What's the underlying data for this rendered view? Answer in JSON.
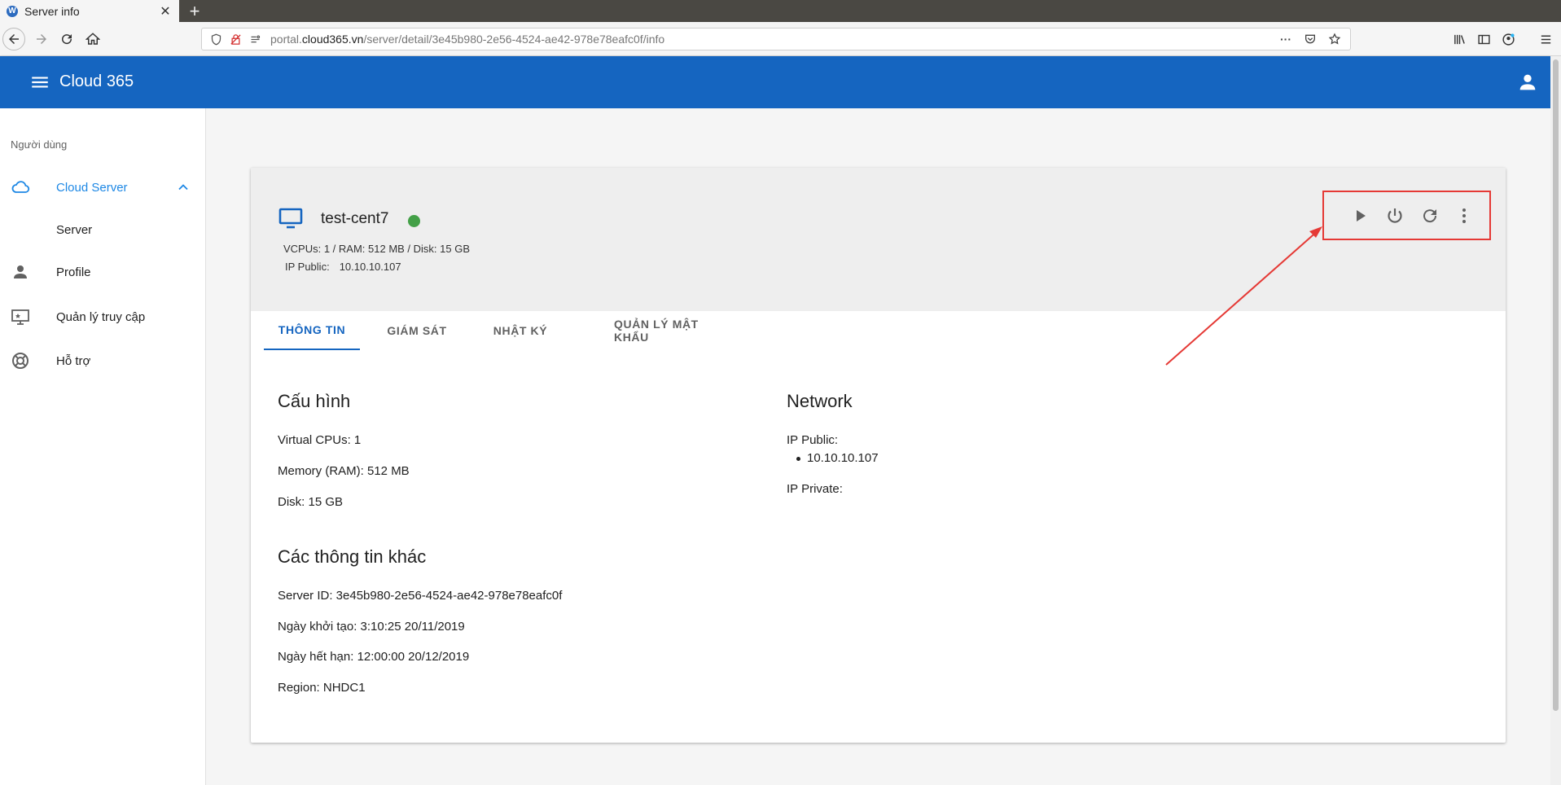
{
  "browser": {
    "tab_title": "Server info",
    "tab_favicon": "W",
    "url_host_prefix": "portal.",
    "url_host": "cloud365.vn",
    "url_path": "/server/detail/3e45b980-2e56-4524-ae42-978e78eafc0f/info",
    "url_more": "···"
  },
  "app": {
    "title": "Cloud 365",
    "brand_color": "#1565c0"
  },
  "sidebar": {
    "heading": "Người dùng",
    "items": [
      {
        "label": "Cloud Server",
        "icon": "cloud-icon",
        "active": true
      },
      {
        "label": "Server",
        "icon": ""
      },
      {
        "label": "Profile",
        "icon": "person-icon"
      },
      {
        "label": "Quản lý truy cập",
        "icon": "monitor-star-icon"
      },
      {
        "label": "Hỗ trợ",
        "icon": "lifebuoy-icon"
      }
    ]
  },
  "server": {
    "name": "test-cent7",
    "status_color": "#43a047",
    "specs": "VCPUs: 1 / RAM: 512 MB / Disk: 15 GB",
    "ip_label": "IP Public:",
    "ip_value": "10.10.10.107"
  },
  "actions": [
    "play-icon",
    "power-icon",
    "refresh-icon",
    "more-vert-icon"
  ],
  "tabs": [
    {
      "label": "THÔNG TIN",
      "active": true
    },
    {
      "label": "GIÁM SÁT"
    },
    {
      "label": "NHẬT KÝ"
    },
    {
      "label": "QUẢN LÝ MẬT KHẨU"
    }
  ],
  "config": {
    "title": "Cấu hình",
    "vcpus": "Virtual CPUs: 1",
    "memory": "Memory (RAM): 512 MB",
    "disk": "Disk: 15 GB"
  },
  "other": {
    "title": "Các thông tin khác",
    "server_id": "Server ID: 3e45b980-2e56-4524-ae42-978e78eafc0f",
    "created": "Ngày khởi tạo: 3:10:25 20/11/2019",
    "expires": "Ngày hết hạn: 12:00:00 20/12/2019",
    "region": "Region: NHDC1"
  },
  "network": {
    "title": "Network",
    "ip_public_label": "IP Public:",
    "ip_public_values": [
      "10.10.10.107"
    ],
    "ip_private_label": "IP Private:"
  },
  "annotation_color": "#e53935"
}
